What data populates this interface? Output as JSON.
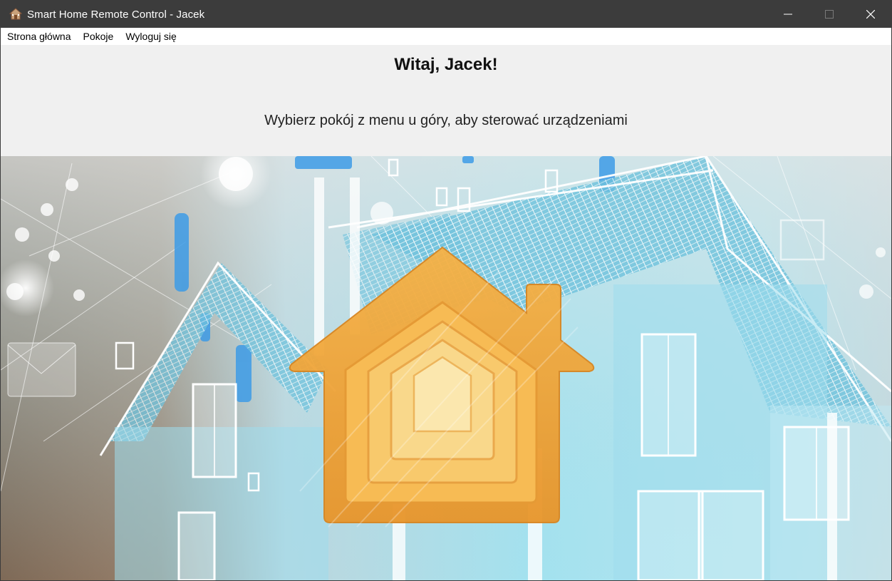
{
  "window": {
    "title": "Smart Home Remote Control - Jacek",
    "app_icon": "house-icon",
    "controls": [
      "minimize-icon",
      "maximize-icon",
      "close-icon"
    ]
  },
  "menu": {
    "items": [
      "Strona główna",
      "Pokoje",
      "Wyloguj się"
    ]
  },
  "main": {
    "greeting": "Witaj, Jacek!",
    "instruction": "Wybierz pokój z menu u góry, aby sterować urządzeniami"
  },
  "hero": {
    "icon": "smart-home-icon",
    "colors": {
      "house": "#f2a43a",
      "sky": "#8fd8ea",
      "wood": "#8a5a3a"
    }
  }
}
